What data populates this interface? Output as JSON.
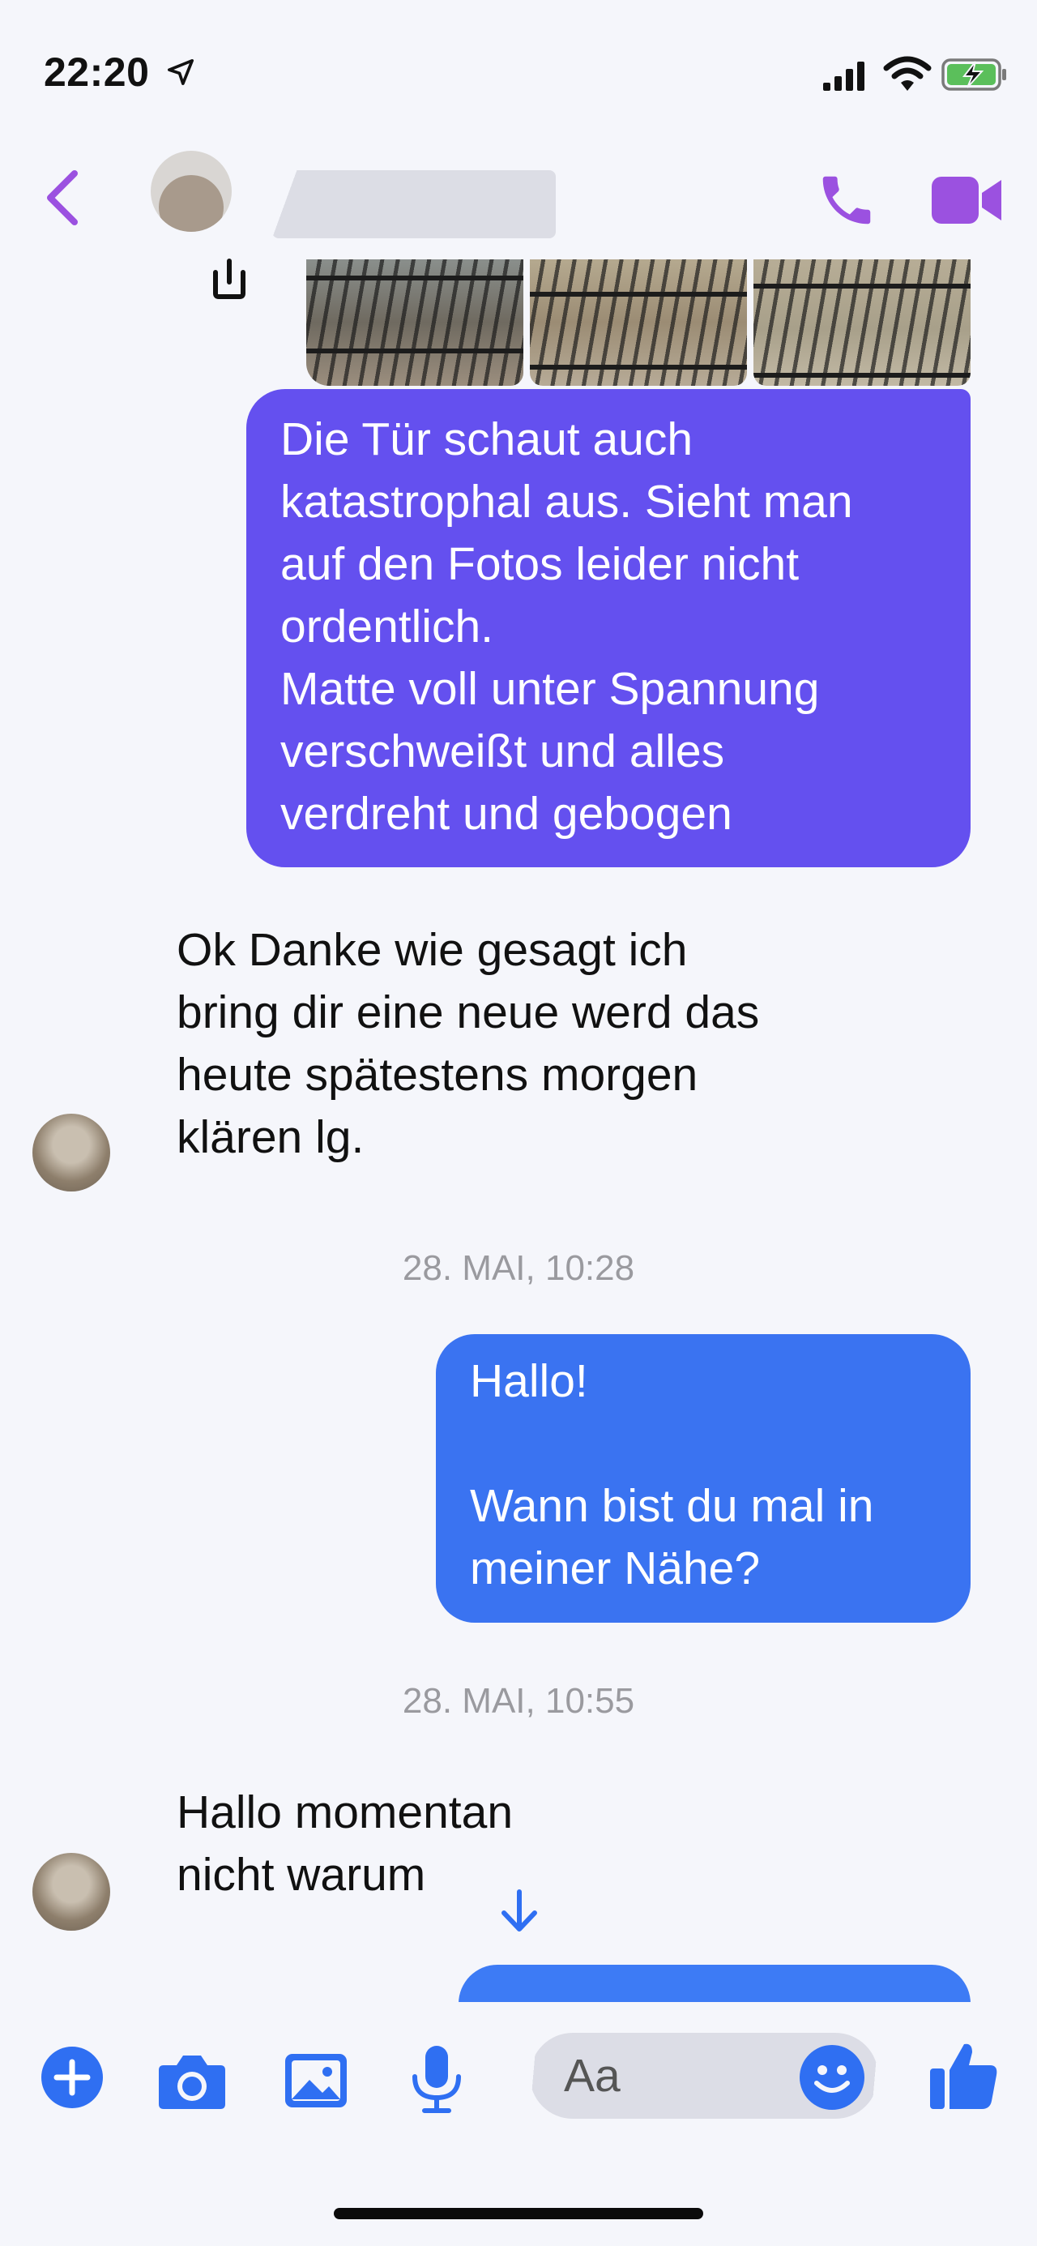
{
  "status_bar": {
    "time": "22:20"
  },
  "header": {
    "back_icon": "chevron-left-icon",
    "call_icon": "phone-icon",
    "video_icon": "video-icon"
  },
  "conversation": {
    "outgoing_1": "Die Tür schaut auch\nkatastrophal aus. Sieht man\nauf den Fotos leider nicht\nordentlich.\nMatte voll unter Spannung\nverschweißt und alles\nverdreht und gebogen",
    "incoming_1": "Ok Danke wie gesagt ich\nbring dir eine neue werd das\nheute spätestens morgen\nklären lg.",
    "timestamp_1": "28. MAI, 10:28",
    "outgoing_2": "Hallo!\n\nWann bist du mal in\nmeiner Nähe?",
    "timestamp_2": "28. MAI, 10:55",
    "incoming_2": "Hallo momentan\nnicht warum"
  },
  "composer": {
    "placeholder": "Aa"
  },
  "colors": {
    "accent": "#9b51e0",
    "outgoing_purple": "#6450ef",
    "outgoing_blue": "#3a73f1",
    "toolbar_blue": "#2f6ff2"
  }
}
